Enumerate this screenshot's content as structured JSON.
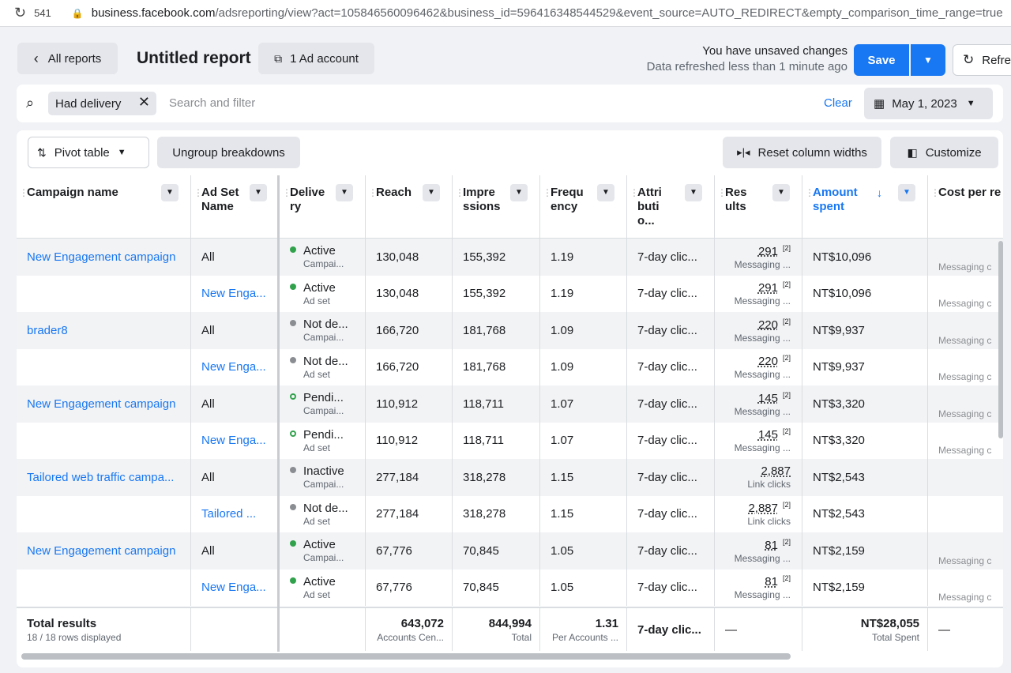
{
  "browser": {
    "tab_number": "541",
    "url_host": "business.facebook.com",
    "url_path": "/adsreporting/view?act=105846560096462&business_id=596416348544529&event_source=AUTO_REDIRECT&empty_comparison_time_range=true"
  },
  "header": {
    "back_label": "All reports",
    "title": "Untitled report",
    "account_label": "1 Ad account",
    "unsaved": "You have unsaved changes",
    "refreshed": "Data refreshed less than 1 minute ago",
    "save_label": "Save",
    "refresh_label": "Refre"
  },
  "filter": {
    "chip": "Had delivery",
    "placeholder": "Search and filter",
    "clear": "Clear",
    "date": "May 1, 2023"
  },
  "toolbar": {
    "pivot": "Pivot table",
    "ungroup": "Ungroup breakdowns",
    "reset": "Reset column widths",
    "customize": "Customize"
  },
  "columns": [
    {
      "line1": "Campaign name",
      "line2": ""
    },
    {
      "line1": "Ad Set",
      "line2": "Name"
    },
    {
      "line1": "Delive",
      "line2": "ry"
    },
    {
      "line1": "Reach",
      "line2": ""
    },
    {
      "line1": "Impre",
      "line2": "ssions"
    },
    {
      "line1": "Frequ",
      "line2": "ency"
    },
    {
      "line1": "Attri",
      "line2": "buti",
      "line3": "o..."
    },
    {
      "line1": "Res",
      "line2": "ults"
    },
    {
      "line1": "Amount",
      "line2": "spent"
    },
    {
      "line1": "Cost per re",
      "line2": ""
    }
  ],
  "rows": [
    {
      "campaign": "New Engagement campaign",
      "adset": "All",
      "adset_link": false,
      "status": "Active",
      "status_sub": "Campai...",
      "dot": "green",
      "reach": "130,048",
      "impressions": "155,392",
      "frequency": "1.19",
      "attribution": "7-day clic...",
      "results": "291",
      "results_note": "[2]",
      "results_sub": "Messaging ...",
      "spent": "NT$10,096",
      "cost_sub": "Messaging c"
    },
    {
      "campaign": "",
      "adset": "New Enga...",
      "adset_link": true,
      "status": "Active",
      "status_sub": "Ad set",
      "dot": "green",
      "reach": "130,048",
      "impressions": "155,392",
      "frequency": "1.19",
      "attribution": "7-day clic...",
      "results": "291",
      "results_note": "[2]",
      "results_sub": "Messaging ...",
      "spent": "NT$10,096",
      "cost_sub": "Messaging c"
    },
    {
      "campaign": "brader8",
      "adset": "All",
      "adset_link": false,
      "status": "Not de...",
      "status_sub": "Campai...",
      "dot": "gray",
      "reach": "166,720",
      "impressions": "181,768",
      "frequency": "1.09",
      "attribution": "7-day clic...",
      "results": "220",
      "results_note": "[2]",
      "results_sub": "Messaging ...",
      "spent": "NT$9,937",
      "cost_sub": "Messaging c"
    },
    {
      "campaign": "",
      "adset": "New Enga...",
      "adset_link": true,
      "status": "Not de...",
      "status_sub": "Ad set",
      "dot": "gray",
      "reach": "166,720",
      "impressions": "181,768",
      "frequency": "1.09",
      "attribution": "7-day clic...",
      "results": "220",
      "results_note": "[2]",
      "results_sub": "Messaging ...",
      "spent": "NT$9,937",
      "cost_sub": "Messaging c"
    },
    {
      "campaign": "New Engagement campaign",
      "adset": "All",
      "adset_link": false,
      "status": "Pendi...",
      "status_sub": "Campai...",
      "dot": "pend",
      "reach": "110,912",
      "impressions": "118,711",
      "frequency": "1.07",
      "attribution": "7-day clic...",
      "results": "145",
      "results_note": "[2]",
      "results_sub": "Messaging ...",
      "spent": "NT$3,320",
      "cost_sub": "Messaging c"
    },
    {
      "campaign": "",
      "adset": "New Enga...",
      "adset_link": true,
      "status": "Pendi...",
      "status_sub": "Ad set",
      "dot": "pend",
      "reach": "110,912",
      "impressions": "118,711",
      "frequency": "1.07",
      "attribution": "7-day clic...",
      "results": "145",
      "results_note": "[2]",
      "results_sub": "Messaging ...",
      "spent": "NT$3,320",
      "cost_sub": "Messaging c"
    },
    {
      "campaign": "Tailored web traffic campa...",
      "adset": "All",
      "adset_link": false,
      "status": "Inactive",
      "status_sub": "Campai...",
      "dot": "gray",
      "reach": "277,184",
      "impressions": "318,278",
      "frequency": "1.15",
      "attribution": "7-day clic...",
      "results": "2,887",
      "results_note": "",
      "results_sub": "Link clicks",
      "spent": "NT$2,543",
      "cost_sub": ""
    },
    {
      "campaign": "",
      "adset": "Tailored ...",
      "adset_link": true,
      "status": "Not de...",
      "status_sub": "Ad set",
      "dot": "gray",
      "reach": "277,184",
      "impressions": "318,278",
      "frequency": "1.15",
      "attribution": "7-day clic...",
      "results": "2,887",
      "results_note": "[2]",
      "results_sub": "Link clicks",
      "spent": "NT$2,543",
      "cost_sub": ""
    },
    {
      "campaign": "New Engagement campaign",
      "adset": "All",
      "adset_link": false,
      "status": "Active",
      "status_sub": "Campai...",
      "dot": "green",
      "reach": "67,776",
      "impressions": "70,845",
      "frequency": "1.05",
      "attribution": "7-day clic...",
      "results": "81",
      "results_note": "[2]",
      "results_sub": "Messaging ...",
      "spent": "NT$2,159",
      "cost_sub": "Messaging c"
    },
    {
      "campaign": "",
      "adset": "New Enga...",
      "adset_link": true,
      "status": "Active",
      "status_sub": "Ad set",
      "dot": "green",
      "reach": "67,776",
      "impressions": "70,845",
      "frequency": "1.05",
      "attribution": "7-day clic...",
      "results": "81",
      "results_note": "[2]",
      "results_sub": "Messaging ...",
      "spent": "NT$2,159",
      "cost_sub": "Messaging c"
    }
  ],
  "totals": {
    "label": "Total results",
    "rows_displayed": "18 / 18 rows displayed",
    "reach": "643,072",
    "reach_sub": "Accounts Cen...",
    "impressions": "844,994",
    "impressions_sub": "Total",
    "frequency": "1.31",
    "frequency_sub": "Per Accounts ...",
    "attribution": "7-day clic...",
    "results": "—",
    "spent": "NT$28,055",
    "spent_sub": "Total Spent",
    "cost": "—"
  },
  "colors": {
    "accent": "#1877f2",
    "active": "#31a24c",
    "inactive": "#8a8d91"
  }
}
